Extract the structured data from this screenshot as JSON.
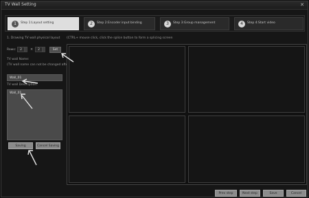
{
  "window": {
    "title": "TV Wall Setting",
    "close_glyph": "✕"
  },
  "steps": [
    {
      "num": "1",
      "label": "Step 1:Layout setting",
      "active": true
    },
    {
      "num": "2",
      "label": "Step 2:Encoder input binding",
      "active": false
    },
    {
      "num": "3",
      "label": "Step 3:Group management",
      "active": false
    },
    {
      "num": "4",
      "label": "Step 4:Start video",
      "active": false
    }
  ],
  "left": {
    "hint": "1. Drawing TV wall physical layout",
    "rows_label": "Rows:",
    "rows_value": "2",
    "cols_value": "2",
    "times": "×",
    "set_label": "Set",
    "name_label": "TV wall Name:",
    "name_note": "(TV wall name can not be changed after saving)",
    "name_value": "Wall_01",
    "desc_label": "TV wall Description:",
    "desc_value": "Wall_01",
    "save_label": "Saving",
    "cancel_label": "Cancel Saving"
  },
  "grid_hint": "(CTRL+ mouse click, click the splice button to form a splicing screen",
  "footer": {
    "prev_label": "Prev step",
    "next_label": "Next step",
    "save_label": "Save",
    "cancel_label": "Cancel"
  }
}
